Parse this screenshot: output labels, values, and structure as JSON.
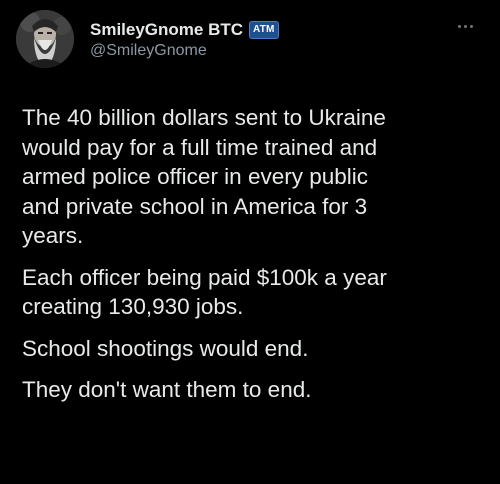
{
  "tweet": {
    "author": {
      "display_name": "SmileyGnome BTC",
      "badge": "ATM",
      "handle": "@SmileyGnome",
      "avatar_icon": "bearded-man-avatar"
    },
    "more_icon": "more-options-icon",
    "paragraphs": [
      "The 40 billion dollars sent to Ukraine\nwould pay for a full time trained and\narmed police officer in every public\nand private school in America for 3\nyears.",
      "Each officer being paid $100k a year\ncreating 130,930 jobs.",
      "School shootings would end.",
      "They don't want them to end."
    ]
  },
  "colors": {
    "background": "#000000",
    "text": "#e7e9ea",
    "secondary_text": "#8b98a5",
    "badge_bg": "#1d4f91"
  }
}
